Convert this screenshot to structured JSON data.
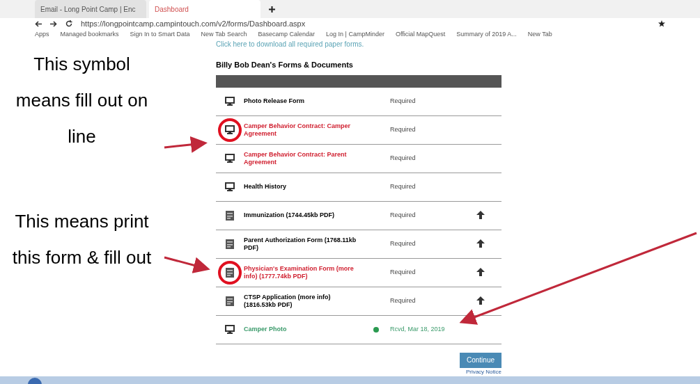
{
  "browser": {
    "tabs": [
      {
        "label": "Email - Long Point Camp | Enc",
        "selected": false
      },
      {
        "label": "Dashboard",
        "selected": true
      }
    ],
    "url": "https://longpointcamp.campintouch.com/v2/forms/Dashboard.aspx",
    "bookmarks": [
      "Apps",
      "Managed bookmarks",
      "Sign In to Smart Data",
      "New Tab Search",
      "Basecamp Calendar",
      "Log In | CampMinder",
      "Official MapQuest",
      "Summary of 2019 A...",
      "New Tab"
    ]
  },
  "download_link": "Click here to download all required paper forms.",
  "forms_title": "Billy Bob Dean's Forms & Documents",
  "rows": [
    {
      "kind": "online",
      "name": "Photo Release Form",
      "status": "Required",
      "highlight": false,
      "circled": false,
      "upload": false,
      "received": false
    },
    {
      "kind": "online",
      "name": "Camper Behavior Contract: Camper Agreement",
      "status": "Required",
      "highlight": true,
      "circled": true,
      "upload": false,
      "received": false
    },
    {
      "kind": "online",
      "name": "Camper Behavior Contract: Parent Agreement",
      "status": "Required",
      "highlight": true,
      "circled": false,
      "upload": false,
      "received": false
    },
    {
      "kind": "online",
      "name": "Health History",
      "status": "Required",
      "highlight": false,
      "circled": false,
      "upload": false,
      "received": false
    },
    {
      "kind": "print",
      "name": "Immunization (1744.45kb PDF)",
      "status": "Required",
      "highlight": false,
      "circled": false,
      "upload": true,
      "received": false
    },
    {
      "kind": "print",
      "name": "Parent Authorization Form (1768.11kb PDF)",
      "status": "Required",
      "highlight": false,
      "circled": false,
      "upload": true,
      "received": false
    },
    {
      "kind": "print",
      "name": "Physician's Examination Form (more info) (1777.74kb PDF)",
      "status": "Required",
      "highlight": true,
      "circled": true,
      "upload": true,
      "received": false
    },
    {
      "kind": "print",
      "name": "CTSP Application (more info) (1816.53kb PDF)",
      "status": "Required",
      "highlight": false,
      "circled": false,
      "upload": true,
      "received": false
    },
    {
      "kind": "online",
      "name": "Camper Photo",
      "status": "Rcvd, Mar 18, 2019",
      "highlight": false,
      "circled": false,
      "upload": false,
      "received": true
    }
  ],
  "continue_button": "Continue",
  "privacy_link": "Privacy Notice",
  "annotations": [
    "This symbol means fill out on line",
    "This means print this form & fill out"
  ]
}
